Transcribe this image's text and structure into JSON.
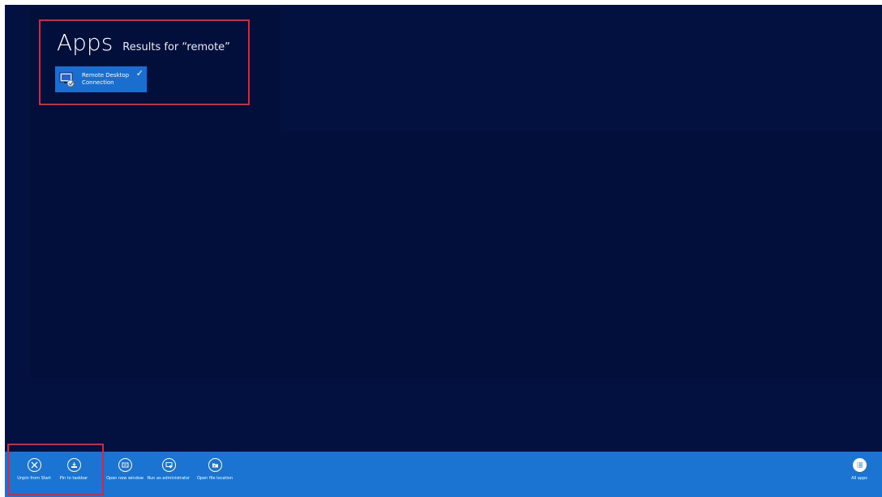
{
  "search": {
    "heading": "Apps",
    "results_label": "Results for “remote”"
  },
  "results": [
    {
      "label": "Remote Desktop Connection",
      "selected": true,
      "icon": "remote-desktop-icon"
    }
  ],
  "app_bar": {
    "commands": [
      {
        "label": "Unpin from Start",
        "icon": "unpin-icon"
      },
      {
        "label": "Pin to taskbar",
        "icon": "pin-taskbar-icon"
      },
      {
        "label": "Open new window",
        "icon": "new-window-icon"
      },
      {
        "label": "Run as administrator",
        "icon": "shield-icon"
      },
      {
        "label": "Open file location",
        "icon": "folder-icon"
      }
    ],
    "all_apps_label": "All apps",
    "all_apps_icon": "list-icon"
  },
  "colors": {
    "background": "#031140",
    "tile": "#1a6ed0",
    "app_bar": "#1b74d1",
    "highlight": "#d8263a"
  }
}
